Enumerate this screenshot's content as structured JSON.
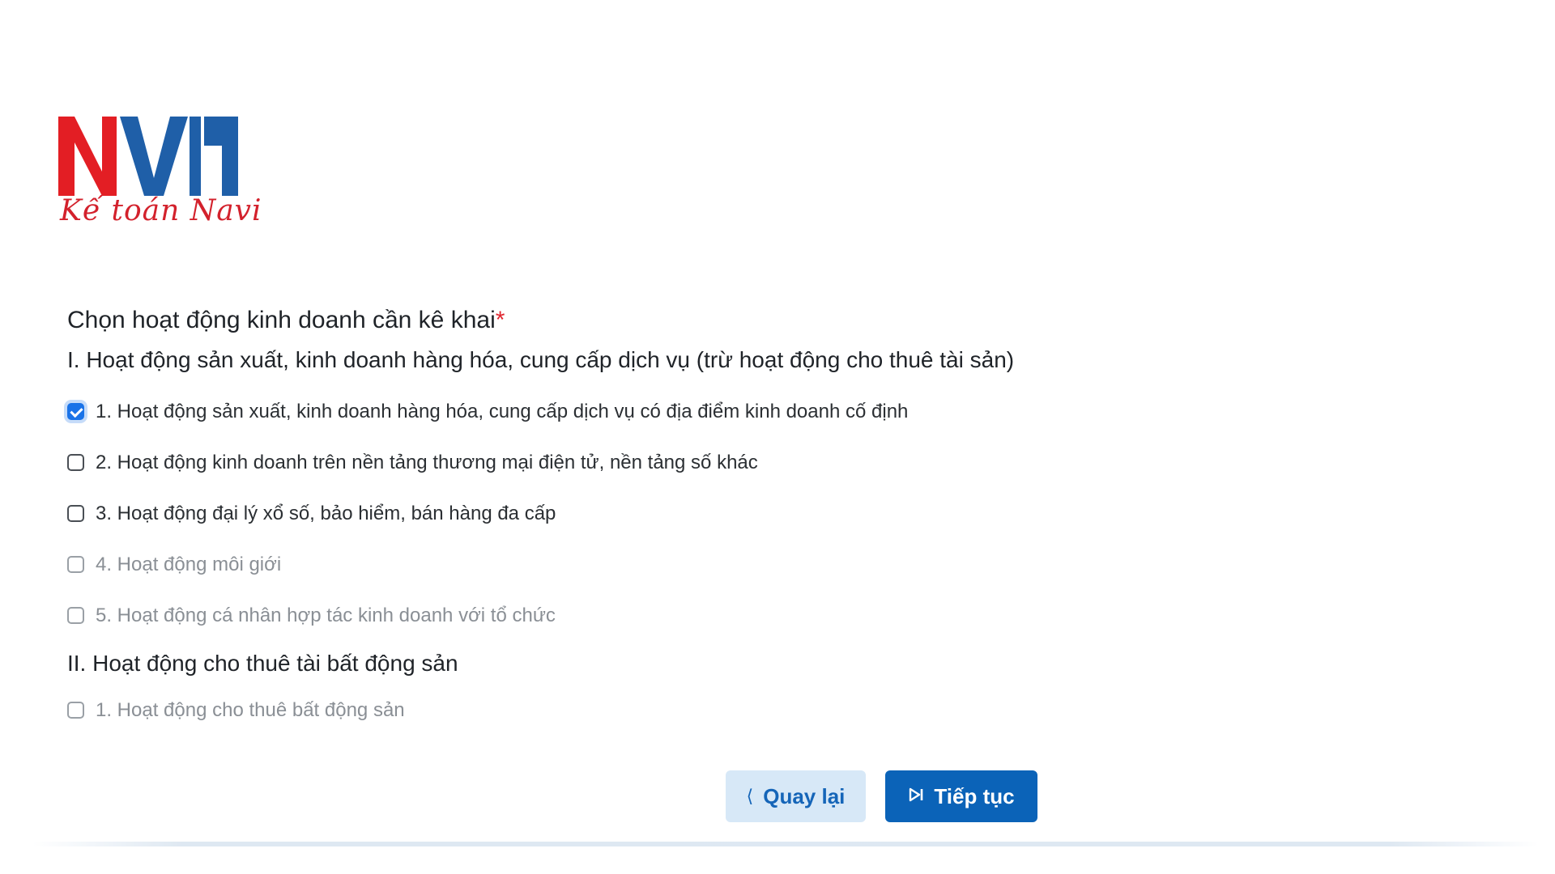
{
  "brand": {
    "logo_text": "NVI",
    "logo_script": "Kế toán Navi",
    "colors": {
      "red": "#e31e24",
      "blue": "#1f5fa8"
    }
  },
  "form": {
    "title": "Chọn hoạt động kinh doanh cần kê khai",
    "required_mark": "*",
    "sections": [
      {
        "heading": "I. Hoạt động sản xuất, kinh doanh hàng hóa, cung cấp dịch vụ (trừ hoạt động cho thuê tài sản)",
        "options": [
          {
            "label": "1. Hoạt động sản xuất, kinh doanh hàng hóa, cung cấp dịch vụ có địa điểm kinh doanh cố định",
            "checked": true,
            "muted": false
          },
          {
            "label": "2. Hoạt động kinh doanh trên nền tảng thương mại điện tử, nền tảng số khác",
            "checked": false,
            "muted": false
          },
          {
            "label": "3. Hoạt động đại lý xổ số, bảo hiểm, bán hàng đa cấp",
            "checked": false,
            "muted": false
          },
          {
            "label": "4. Hoạt động môi giới",
            "checked": false,
            "muted": true
          },
          {
            "label": "5. Hoạt động cá nhân hợp tác kinh doanh với tổ chức",
            "checked": false,
            "muted": true
          }
        ]
      },
      {
        "heading": "II. Hoạt động cho thuê tài bất động sản",
        "options": [
          {
            "label": "1. Hoạt động cho thuê bất động sản",
            "checked": false,
            "muted": true
          }
        ]
      }
    ]
  },
  "actions": {
    "back_label": "Quay lại",
    "back_icon": "chevron-left-icon",
    "next_label": "Tiếp tục",
    "next_icon": "skip-forward-icon",
    "colors": {
      "back_bg": "#d7e8f7",
      "next_bg": "#0b63b8",
      "check_accent": "#1a73e8"
    }
  }
}
